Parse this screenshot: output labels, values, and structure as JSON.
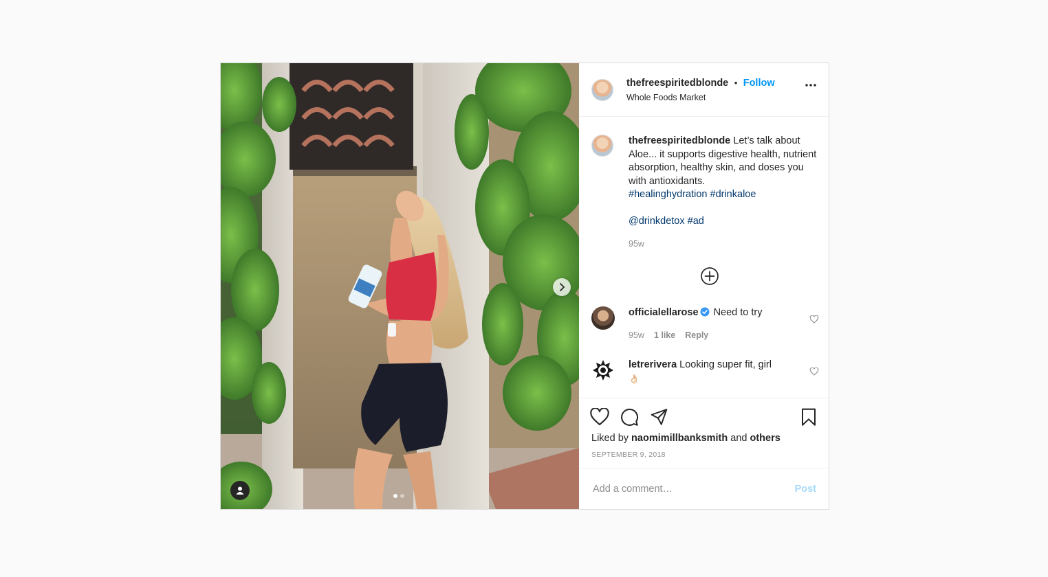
{
  "post": {
    "author": {
      "username": "thefreespiritedblonde",
      "separator": "•",
      "follow_label": "Follow",
      "location": "Whole Foods Market"
    },
    "more_icon": "more-horizontal-icon",
    "media": {
      "image_count": 2,
      "active_index": 1,
      "next_icon": "chevron-right-icon",
      "tag_icon": "user-tag-icon"
    },
    "caption": {
      "username": "thefreespiritedblonde",
      "text": " Let’s talk about Aloe... it supports digestive health, nutrient absorption, healthy skin, and doses you with antioxidants.",
      "hashtags_line": "#healinghydration #drinkaloe",
      "mentions_line": "@drinkdetox #ad",
      "timestamp": "95w"
    },
    "load_more_icon": "plus-circle-icon",
    "comments": [
      {
        "username": "officialellarose",
        "verified": true,
        "text": " Need to try",
        "time": "95w",
        "likes": "1 like",
        "reply": "Reply"
      },
      {
        "username": "letrerivera",
        "verified": false,
        "text": " Looking super fit, girl",
        "emoji": "👌🏻"
      }
    ],
    "actions": {
      "like_icon": "heart-icon",
      "comment_icon": "comment-icon",
      "share_icon": "send-icon",
      "save_icon": "bookmark-icon"
    },
    "likes": {
      "prefix": "Liked by ",
      "user": "naomimillbanksmith",
      "middle": " and ",
      "others": "others"
    },
    "date": "SEPTEMBER 9, 2018",
    "add_comment": {
      "placeholder": "Add a comment…",
      "post_label": "Post"
    },
    "colors": {
      "link_blue": "#0095f6",
      "hashtag_blue": "#00376b",
      "muted": "#8e8e8e",
      "border": "#dbdbdb"
    }
  }
}
